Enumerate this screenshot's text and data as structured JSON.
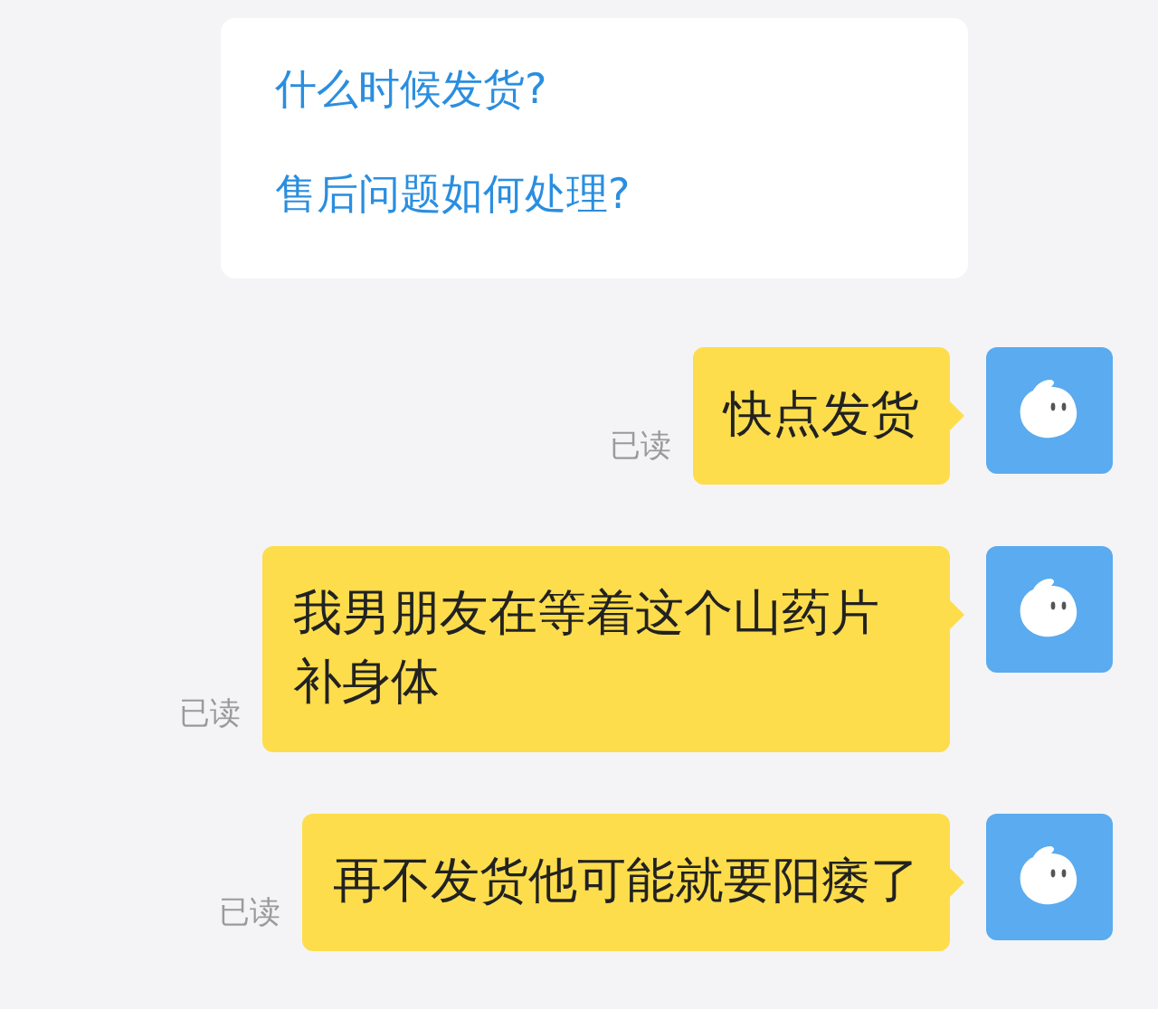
{
  "quick_questions": [
    "什么时候发货?",
    "售后问题如何处理?"
  ],
  "messages": [
    {
      "status": "已读",
      "text": "快点发货"
    },
    {
      "status": "已读",
      "text": "我男朋友在等着这个山药片补身体"
    },
    {
      "status": "已读",
      "text": "再不发货他可能就要阳痿了"
    }
  ]
}
